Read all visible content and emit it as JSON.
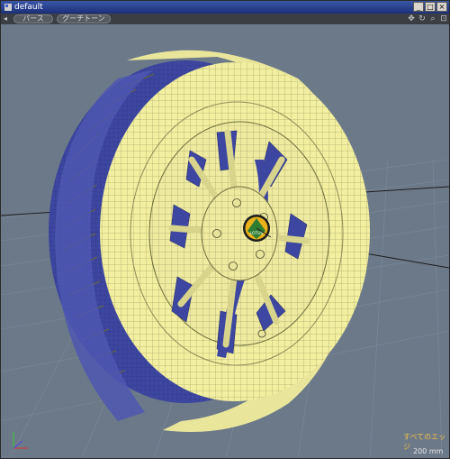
{
  "window": {
    "title": "default"
  },
  "toolbar": {
    "view_mode_tab": "パース",
    "shading_tab": "グーチトーン"
  },
  "viewport": {
    "selection_mode_label": "すべてのエッジ",
    "scale_label": "200 mm",
    "hub_badge_text": "LOTUS"
  },
  "colors": {
    "background": "#6c7989",
    "wire_mesh": "#f2efa0",
    "shadow_mesh": "#3d46a0",
    "title_bar": "#2a419a",
    "label_accent": "#f0c048"
  },
  "icons": [
    "app-icon",
    "minimize-icon",
    "maximize-icon",
    "close-icon",
    "move-view-icon",
    "rotate-view-icon",
    "zoom-view-icon",
    "fit-view-icon",
    "axis-gizmo-icon"
  ]
}
